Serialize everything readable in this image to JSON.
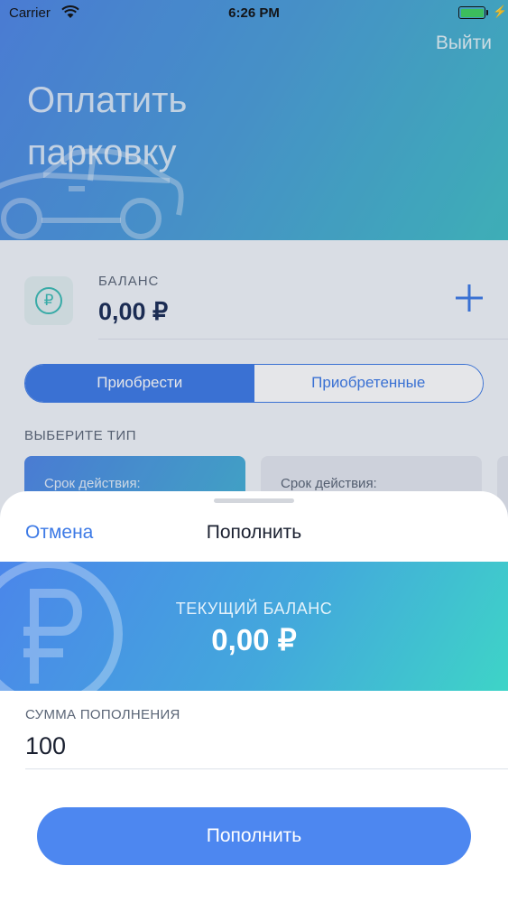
{
  "status_bar": {
    "carrier": "Carrier",
    "time": "6:26 PM"
  },
  "header": {
    "logout_label": "Выйти",
    "title": "Оплатить парковку"
  },
  "balance": {
    "label": "БАЛАНС",
    "value": "0,00 ₽",
    "icon": "ruble-icon"
  },
  "segments": [
    {
      "label": "Приобрести",
      "active": true
    },
    {
      "label": "Приобретенные",
      "active": false
    }
  ],
  "type_section": {
    "label": "ВЫБЕРИТЕ ТИП",
    "cards": [
      {
        "label": "Срок действия:"
      },
      {
        "label": "Срок действия:"
      }
    ]
  },
  "sheet": {
    "cancel_label": "Отмена",
    "title": "Пополнить",
    "current_balance_label": "ТЕКУЩИЙ БАЛАНС",
    "current_balance_value": "0,00 ₽",
    "amount_label": "СУММА ПОПОЛНЕНИЯ",
    "amount_value": "100",
    "submit_label": "Пополнить"
  },
  "colors": {
    "accent": "#3d7ae6",
    "teal": "#3bbcb4",
    "title_dark": "#1a2c55"
  }
}
